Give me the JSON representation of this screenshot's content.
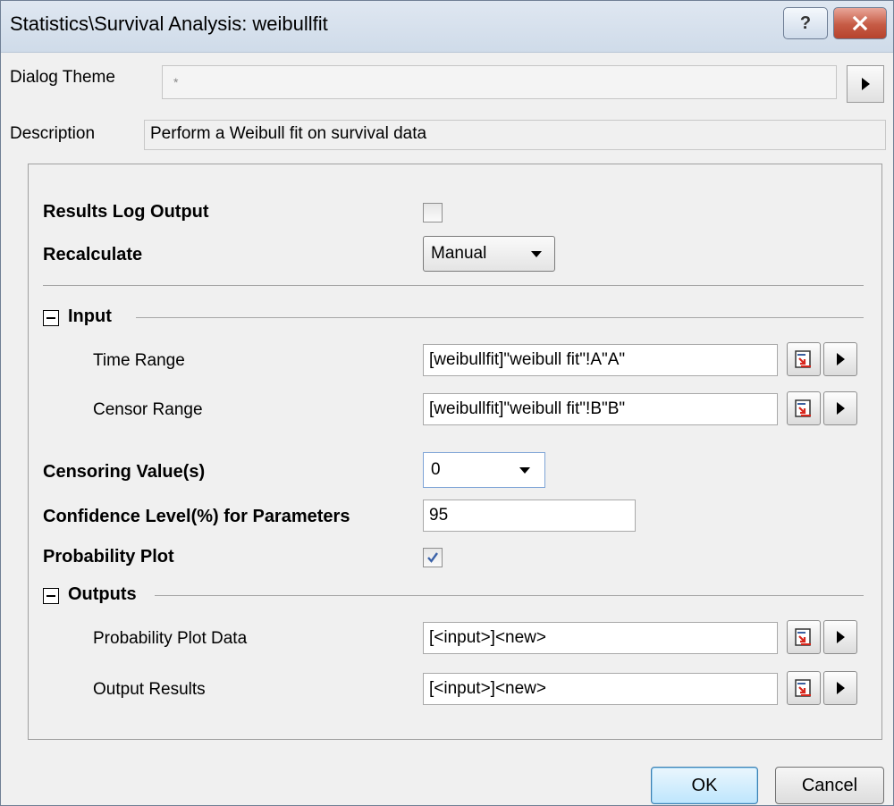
{
  "window": {
    "title": "Statistics\\Survival Analysis: weibullfit",
    "help_label": "?",
    "close_label": "✕"
  },
  "theme": {
    "label": "Dialog Theme",
    "value": "*"
  },
  "description": {
    "label": "Description",
    "value": "Perform a Weibull fit on survival data"
  },
  "settings": {
    "results_log_output": {
      "label": "Results Log Output",
      "checked": false
    },
    "recalculate": {
      "label": "Recalculate",
      "value": "Manual"
    }
  },
  "input": {
    "header": "Input",
    "time_range": {
      "label": "Time Range",
      "value": "[weibullfit]\"weibull fit\"!A\"A\""
    },
    "censor_range": {
      "label": "Censor Range",
      "value": "[weibullfit]\"weibull fit\"!B\"B\""
    }
  },
  "censoring": {
    "label": "Censoring Value(s)",
    "value": "0"
  },
  "confidence": {
    "label": "Confidence Level(%) for Parameters",
    "value": "95"
  },
  "probability_plot": {
    "label": "Probability Plot",
    "checked": true
  },
  "outputs": {
    "header": "Outputs",
    "probability_plot_data": {
      "label": "Probability Plot Data",
      "value": "[<input>]<new>"
    },
    "output_results": {
      "label": "Output Results",
      "value": "[<input>]<new>"
    }
  },
  "buttons": {
    "ok": "OK",
    "cancel": "Cancel"
  },
  "colors": {
    "accent": "#3c7fb1",
    "close": "#c65b45",
    "check": "#3b62a8",
    "range_icon_red": "#d8261c"
  }
}
